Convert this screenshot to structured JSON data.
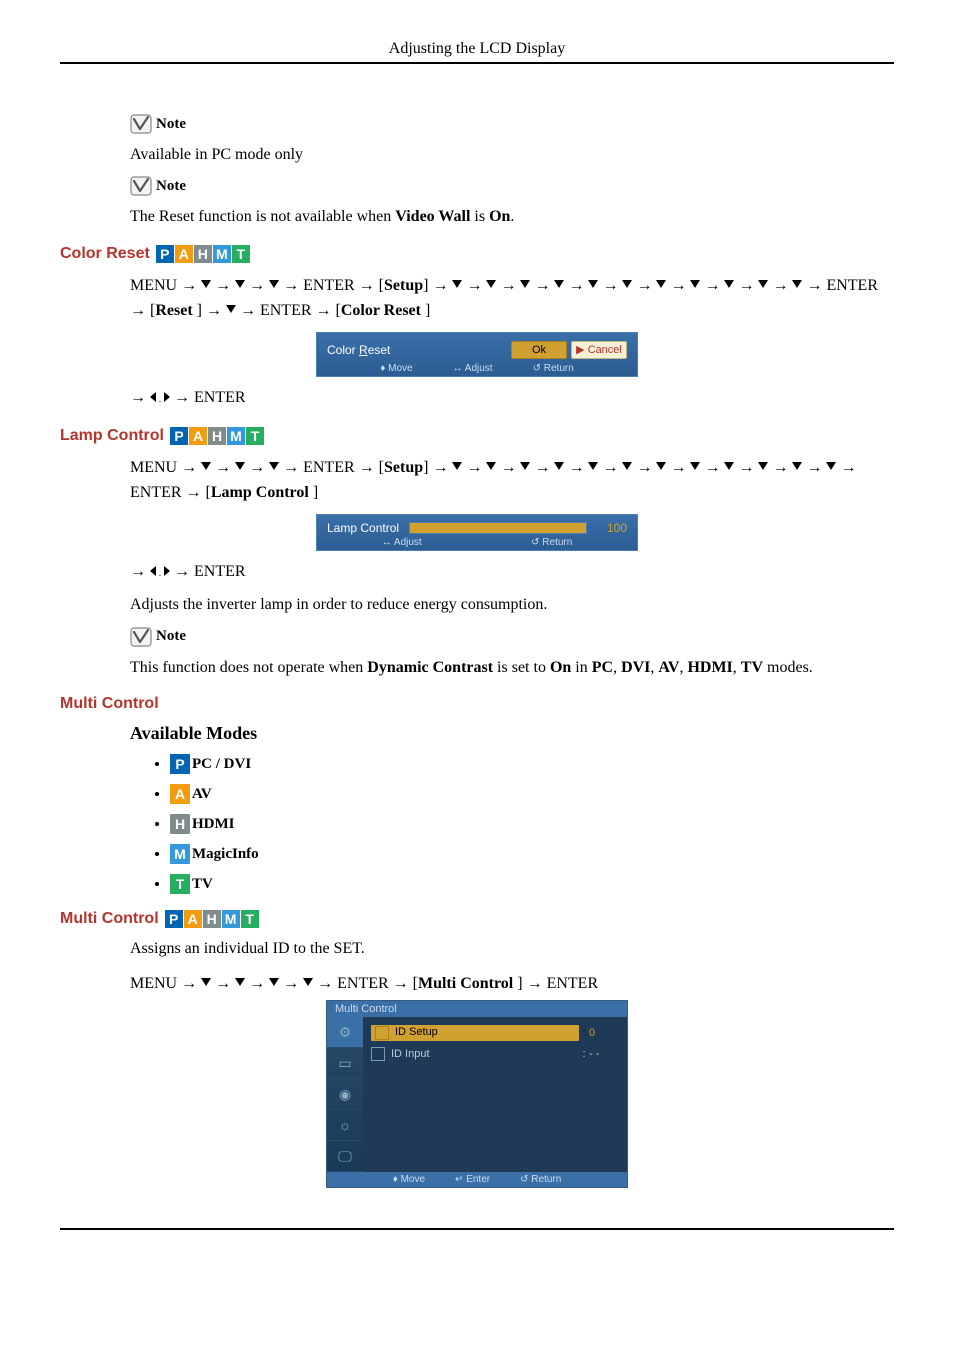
{
  "header": {
    "title": "Adjusting the LCD Display"
  },
  "notes": {
    "label": "Note",
    "n1": "Available in PC mode only",
    "n2_prefix": "The Reset function is not available when ",
    "n2_b1": "Video Wall",
    "n2_mid": " is ",
    "n2_b2": "On",
    "n2_suffix": ".",
    "n3_prefix": "This function does not operate when ",
    "n3_b1": "Dynamic Contrast",
    "n3_mid1": " is set to ",
    "n3_b2": "On",
    "n3_mid2": " in ",
    "n3_b3": "PC",
    "n3_c1": ", ",
    "n3_b4": "DVI",
    "n3_c2": ", ",
    "n3_b5": "AV",
    "n3_c3": ", ",
    "n3_b6": "HDMI",
    "n3_c4": ", ",
    "n3_b7": "TV",
    "n3_suffix": " modes."
  },
  "sections": {
    "color_reset": "Color Reset",
    "lamp_control": "Lamp Control",
    "multi_control": "Multi Control",
    "multi_control2": "Multi Control",
    "available_modes": "Available Modes"
  },
  "nav": {
    "menu": "MENU",
    "enter": "ENTER",
    "arrow": " → ",
    "setup": "Setup",
    "reset": "Reset ",
    "color_reset": "Color Reset ",
    "lamp_control": "Lamp Control ",
    "multi_control": "Multi Control "
  },
  "lamp_desc": "Adjusts the inverter lamp in order to reduce energy consumption.",
  "multi_desc": "Assigns an individual ID to the SET.",
  "mode_letters": {
    "p": "P",
    "a": "A",
    "h": "H",
    "m": "M",
    "t": "T"
  },
  "mode_labels": {
    "pc_dvi": "PC / DVI",
    "av": "AV",
    "hdmi": "HDMI",
    "magicinfo": "MagicInfo",
    "tv": "TV"
  },
  "osd": {
    "confirm": {
      "label_pre": "Color",
      "label_u": "R",
      "label_post": "eset",
      "ok": "Ok",
      "cancel": "Cancel",
      "help_move": "Move",
      "help_adjust": "Adjust",
      "help_return": "Return"
    },
    "slider": {
      "label": "Lamp Control",
      "value": "100",
      "help_adjust": "Adjust",
      "help_return": "Return"
    },
    "multi": {
      "title": "Multi Control",
      "id_setup": "ID Setup",
      "id_input": "ID Input",
      "val_setup": "0",
      "val_input": "- -",
      "colon": ":",
      "footer_move": "Move",
      "footer_enter": "Enter",
      "footer_return": "Return"
    }
  }
}
